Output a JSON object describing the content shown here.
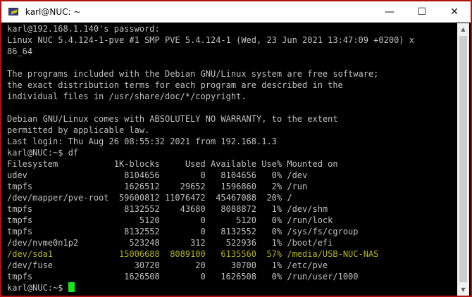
{
  "window": {
    "title": "karl@NUC: ~",
    "controls": {
      "minimize": "—",
      "maximize": "☐",
      "close": "✕"
    },
    "icon": "putty-icon"
  },
  "terminal": {
    "lines": [
      "karl@192.168.1.140's password:",
      "Linux NUC 5.4.124-1-pve #1 SMP PVE 5.4.124-1 (Wed, 23 Jun 2021 13:47:09 +0200) x",
      "86_64",
      "",
      "The programs included with the Debian GNU/Linux system are free software;",
      "the exact distribution terms for each program are described in the",
      "individual files in /usr/share/doc/*/copyright.",
      "",
      "Debian GNU/Linux comes with ABSOLUTELY NO WARRANTY, to the extent",
      "permitted by applicable law.",
      "Last login: Thu Aug 26 08:55:32 2021 from 192.168.1.3",
      "karl@NUC:~$ df",
      "Filesystem           1K-blocks     Used Available Use% Mounted on",
      "udev                   8104656        0   8104656   0% /dev",
      "tmpfs                  1626512    29652   1596860   2% /run",
      "/dev/mapper/pve-root  59600812 11076472  45467088  20% /",
      "tmpfs                  8132552    43680   8088872   1% /dev/shm",
      "tmpfs                     5120        0      5120   0% /run/lock",
      "tmpfs                  8132552        0   8132552   0% /sys/fs/cgroup",
      "/dev/nvme0n1p2          523248      312    522936   1% /boot/efi",
      "/dev/sda1             15006688  8089100   6135560  57% /media/USB-NUC-NAS",
      "/dev/fuse                30720       20     30700   1% /etc/pve",
      "tmpfs                  1626508        0   1626508   0% /run/user/1000",
      "karl@NUC:~$ "
    ],
    "highlight_line_index": 20,
    "highlight_color": "#b7b31a",
    "text_color": "#c0c0c0",
    "cursor_color": "#19e619"
  },
  "colors": {
    "border": "#b01212",
    "background": "#000000"
  }
}
